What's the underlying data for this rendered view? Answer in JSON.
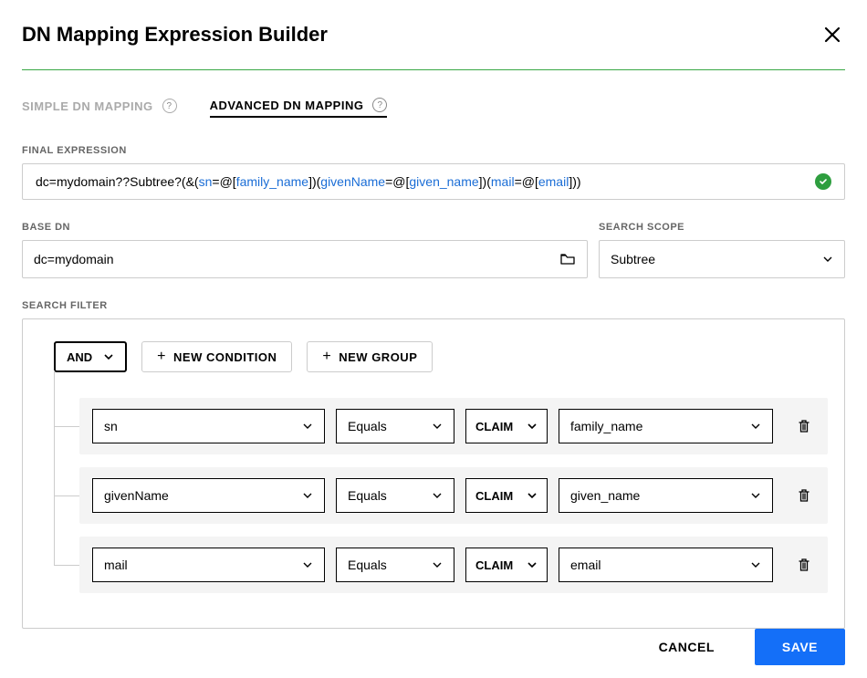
{
  "header": {
    "title": "DN Mapping Expression Builder"
  },
  "tabs": {
    "simple": "SIMPLE DN MAPPING",
    "advanced": "ADVANCED DN MAPPING"
  },
  "final_expression": {
    "label": "FINAL EXPRESSION",
    "parts": {
      "p0": "dc=mydomain??Subtree?(&(",
      "p1": "sn",
      "p2": "=@[",
      "p3": "family_name",
      "p4": "])(",
      "p5": "givenName",
      "p6": "=@[",
      "p7": "given_name",
      "p8": "])(",
      "p9": "mail",
      "p10": "=@[",
      "p11": "email",
      "p12": "]))"
    }
  },
  "base_dn": {
    "label": "BASE DN",
    "value": "dc=mydomain"
  },
  "search_scope": {
    "label": "SEARCH SCOPE",
    "value": "Subtree"
  },
  "search_filter": {
    "label": "SEARCH FILTER",
    "operator": "AND",
    "new_condition": "NEW CONDITION",
    "new_group": "NEW GROUP",
    "conditions": [
      {
        "attr": "sn",
        "op": "Equals",
        "type": "CLAIM",
        "value": "family_name"
      },
      {
        "attr": "givenName",
        "op": "Equals",
        "type": "CLAIM",
        "value": "given_name"
      },
      {
        "attr": "mail",
        "op": "Equals",
        "type": "CLAIM",
        "value": "email"
      }
    ]
  },
  "footer": {
    "cancel": "CANCEL",
    "save": "SAVE"
  }
}
